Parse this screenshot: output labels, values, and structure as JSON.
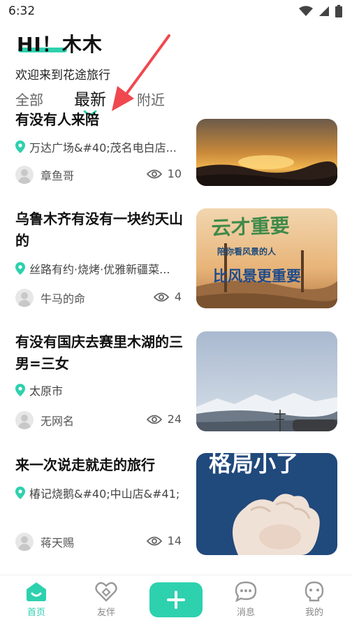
{
  "status_bar": {
    "time": "6:32"
  },
  "header": {
    "greeting": "HI！木木",
    "welcome": "欢迎来到花途旅行"
  },
  "tabs": [
    {
      "label": "全部",
      "active": false
    },
    {
      "label": "最新",
      "active": true
    },
    {
      "label": "附近",
      "active": false
    }
  ],
  "posts": [
    {
      "title": "有没有人来陪",
      "location": "万达广场&#40;茂名电白店...",
      "user": "章鱼哥",
      "views": "10",
      "image": "sunset-landscape"
    },
    {
      "title": "乌鲁木齐有没有一块约天山的",
      "location": "丝路有约·烧烤·优雅新疆菜...",
      "user": "牛马的命",
      "views": "4",
      "image": "sign-landscape"
    },
    {
      "title": "有没有国庆去赛里木湖的三男=三女",
      "location": "太原市",
      "user": "无网名",
      "views": "24",
      "image": "snow-mountains"
    },
    {
      "title": "来一次说走就走的旅行",
      "location": "椿记烧鹅&#40;中山店&#41;",
      "user": "蒋天赐",
      "views": "14",
      "image": "cartoon-fist"
    }
  ],
  "thumb_text": {
    "sign_big1": "云才重要",
    "sign_small": "陪你看风景的人",
    "sign_big2": "比风景更重要",
    "fist": "格局小了"
  },
  "bottom_nav": [
    {
      "label": "首页",
      "icon": "home-icon",
      "active": true
    },
    {
      "label": "友伴",
      "icon": "heart-link-icon",
      "active": false
    },
    {
      "label": "",
      "icon": "plus-icon",
      "active": false
    },
    {
      "label": "消息",
      "icon": "chat-icon",
      "active": false
    },
    {
      "label": "我的",
      "icon": "profile-icon",
      "active": false
    }
  ],
  "colors": {
    "accent": "#2dd1ae",
    "arrow": "#f0484e"
  }
}
